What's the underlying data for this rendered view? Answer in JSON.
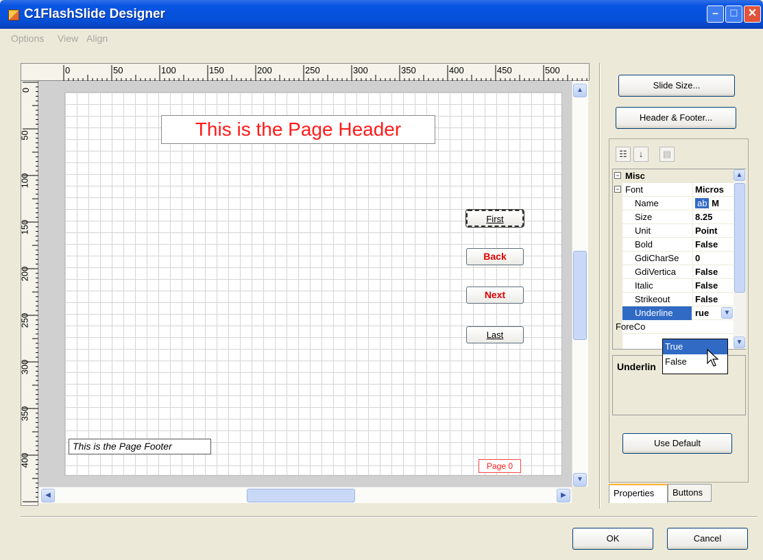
{
  "window": {
    "title": "C1FlashSlide Designer"
  },
  "menu": [
    "Options",
    "View",
    "Align"
  ],
  "ruler": {
    "h_labels": [
      "0",
      "50",
      "100",
      "150",
      "200",
      "250",
      "300",
      "350",
      "400",
      "450",
      "500"
    ],
    "v_labels": [
      "0",
      "50",
      "100",
      "150",
      "200",
      "250",
      "300",
      "350",
      "400"
    ]
  },
  "slide": {
    "header_text": "This is the Page Header",
    "footer_text": "This is the Page Footer",
    "page_number": "Page 0",
    "buttons": [
      "First",
      "Back",
      "Next",
      "Last"
    ]
  },
  "side": {
    "slide_size": "Slide Size...",
    "header_footer": "Header & Footer...",
    "use_default": "Use Default"
  },
  "toolbar_icons": [
    "categorized-icon",
    "alphabetical-icon",
    "property-pages-icon"
  ],
  "grid": {
    "category": "Misc",
    "font_name": "Font",
    "font_value": "Micros",
    "rows": [
      {
        "name": "Name",
        "value": "M",
        "swatch": "ab"
      },
      {
        "name": "Size",
        "value": "8.25"
      },
      {
        "name": "Unit",
        "value": "Point"
      },
      {
        "name": "Bold",
        "value": "False"
      },
      {
        "name": "GdiCharSe",
        "value": "0"
      },
      {
        "name": "GdiVertica",
        "value": "False"
      },
      {
        "name": "Italic",
        "value": "False"
      },
      {
        "name": "Strikeout",
        "value": "False"
      },
      {
        "name": "Underline",
        "value": "rue"
      }
    ],
    "forecolor_name": "ForeCo",
    "dropdown_options": [
      "True",
      "False"
    ],
    "description_title": "Underlin"
  },
  "tabs": {
    "properties": "Properties",
    "buttons": "Buttons"
  },
  "dialog": {
    "ok": "OK",
    "cancel": "Cancel"
  }
}
